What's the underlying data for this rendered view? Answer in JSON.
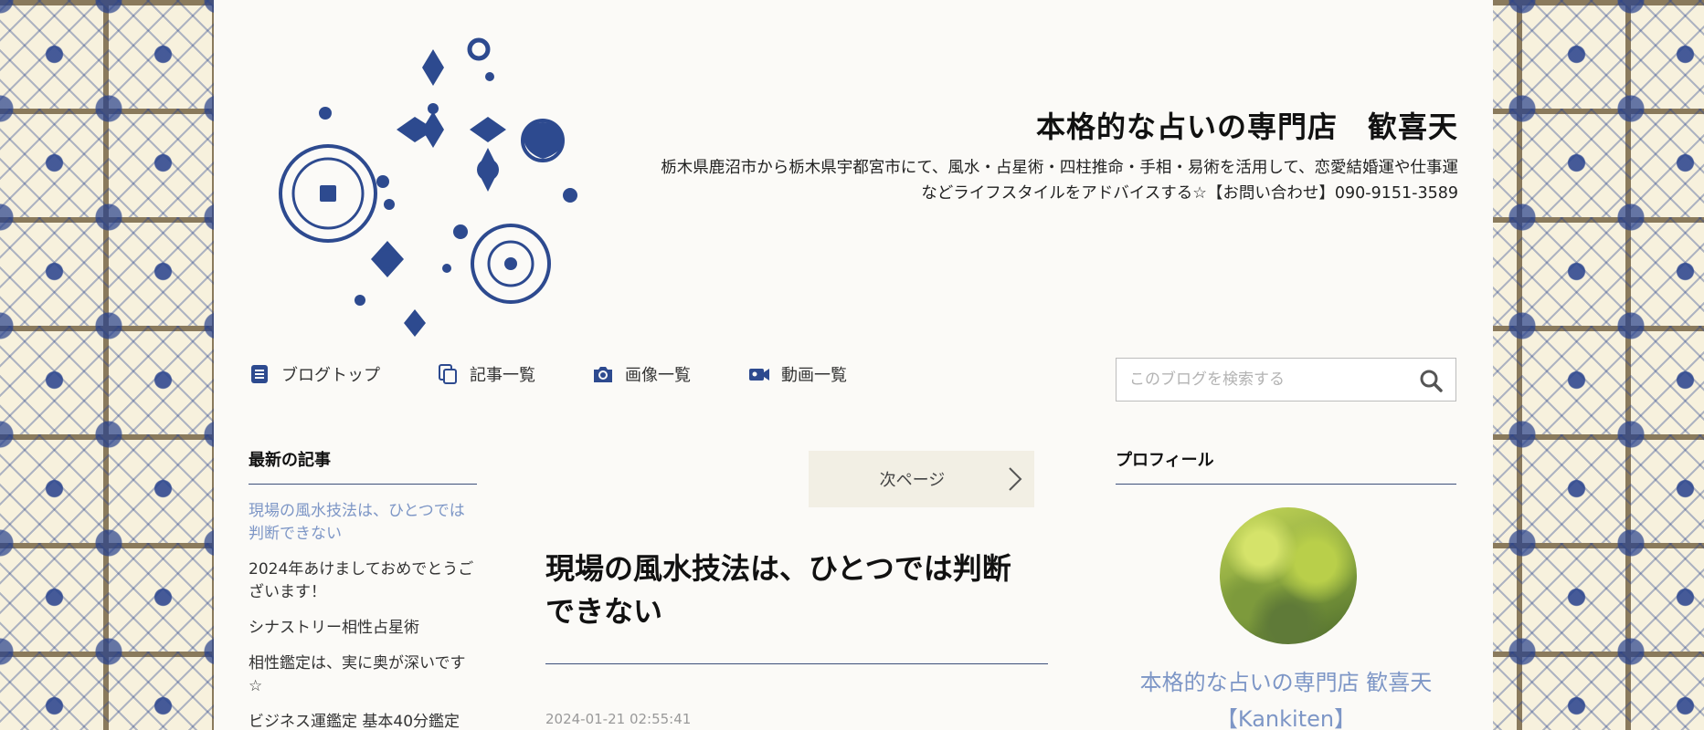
{
  "header": {
    "site_title": "本格的な占いの専門店　歓喜天",
    "description": "栃木県鹿沼市から栃木県宇都宮市にて、風水・占星術・四柱推命・手相・易術を活用して、恋愛結婚運や仕事運などライフスタイルをアドバイスする☆【お問い合わせ】090-9151-3589"
  },
  "nav": {
    "items": [
      {
        "label": "ブログトップ",
        "icon": "document-icon"
      },
      {
        "label": "記事一覧",
        "icon": "copy-icon"
      },
      {
        "label": "画像一覧",
        "icon": "camera-icon"
      },
      {
        "label": "動画一覧",
        "icon": "video-camera-icon"
      }
    ]
  },
  "search": {
    "placeholder": "このブログを検索する",
    "icon": "search-icon"
  },
  "sidebar_left": {
    "heading": "最新の記事",
    "recent_posts": [
      "現場の風水技法は、ひとつでは判断できない",
      "2024年あけましておめでとうございます！",
      "シナストリー相性占星術",
      "相性鑑定は、実に奥が深いです☆",
      "ビジネス運鑑定 基本40分鑑定"
    ]
  },
  "article": {
    "next_page": "次ページ",
    "title": "現場の風水技法は、ひとつでは判断できない",
    "date": "2024-01-21 02:55:41"
  },
  "sidebar_right": {
    "heading": "プロフィール",
    "profile_name": "本格的な占いの専門店 歓喜天【Kankiten】"
  },
  "colors": {
    "accent_blue": "#26408c",
    "link_current": "#7d96c6",
    "background_page": "#fbfaf7"
  }
}
